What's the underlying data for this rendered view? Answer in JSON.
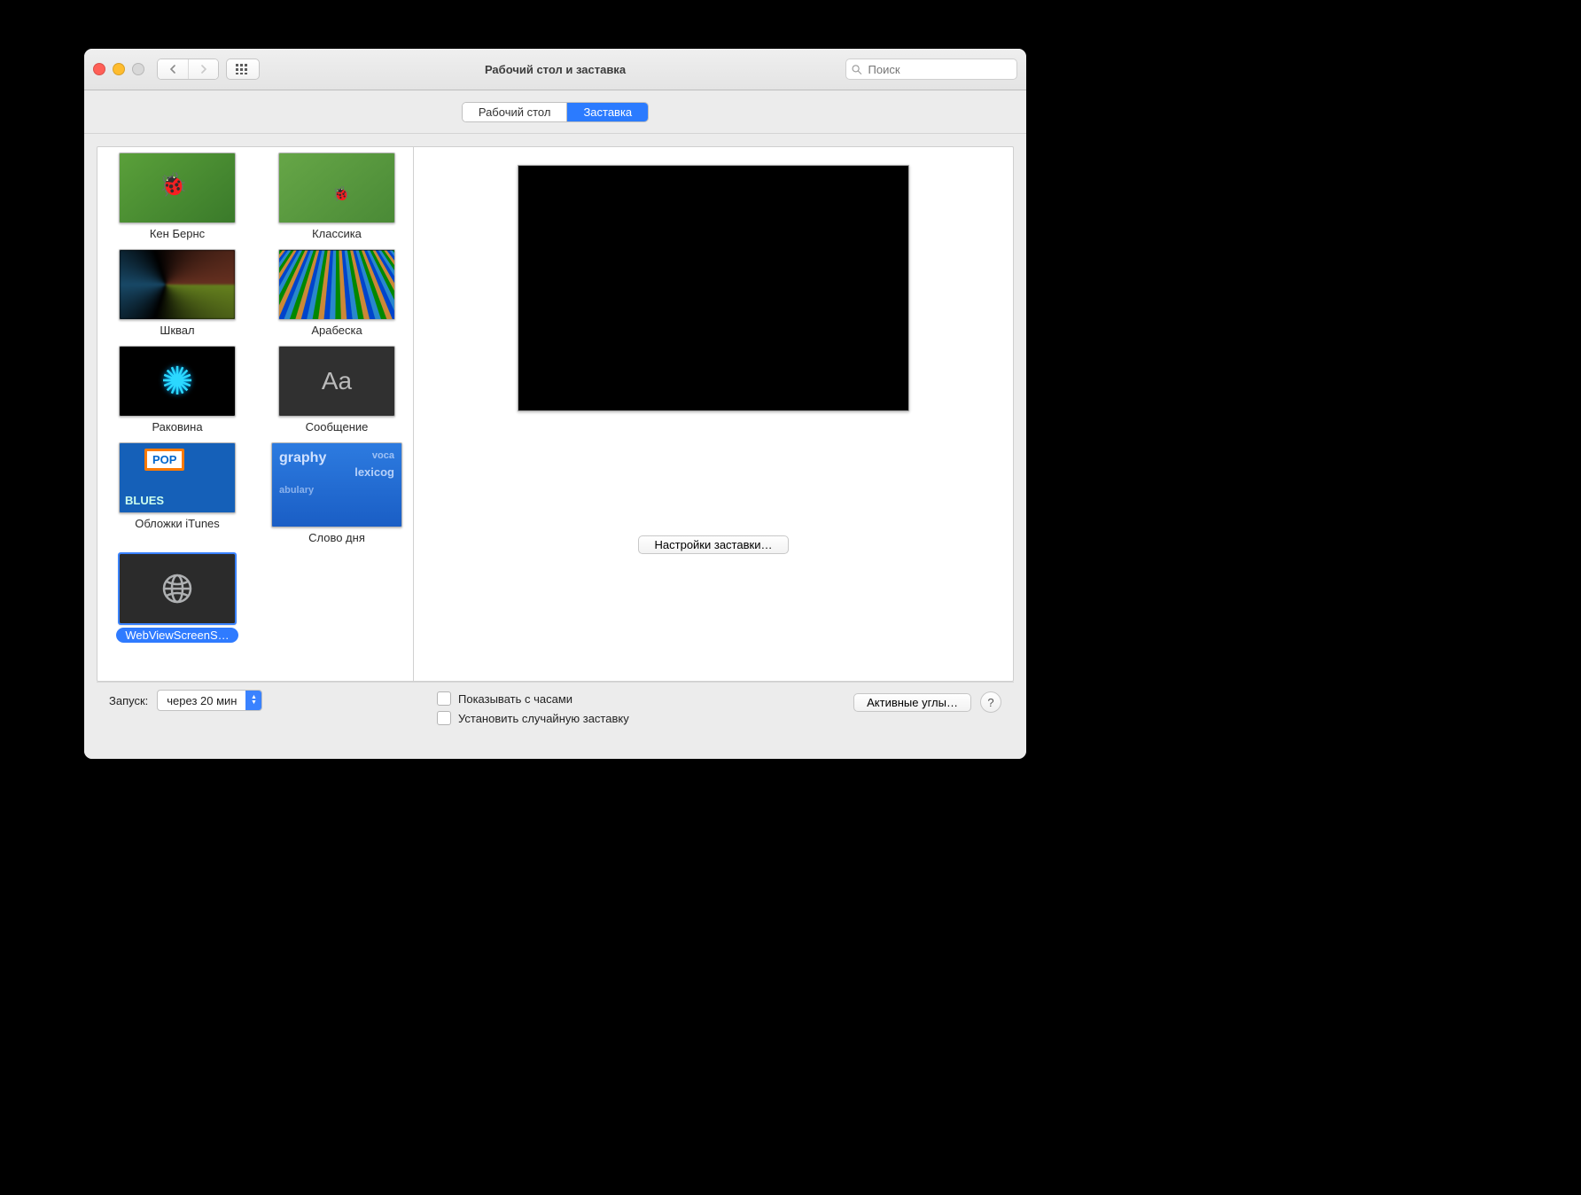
{
  "window": {
    "title": "Рабочий стол и заставка"
  },
  "search": {
    "placeholder": "Поиск"
  },
  "tabs": {
    "desktop": "Рабочий стол",
    "screensaver": "Заставка"
  },
  "savers": [
    {
      "label": "Кен Бернс"
    },
    {
      "label": "Классика"
    },
    {
      "label": "Шквал"
    },
    {
      "label": "Арабеска"
    },
    {
      "label": "Раковина"
    },
    {
      "label": "Сообщение"
    },
    {
      "label": "Обложки iTunes"
    },
    {
      "label": "Слово дня"
    },
    {
      "label": "WebViewScreenS…",
      "selected": true
    }
  ],
  "word_thumb": {
    "l1": "graphy",
    "l2": "voca",
    "l3": "lexicog",
    "l4": "abulary"
  },
  "msg_thumb": "Aa",
  "screensaver_options_button": "Настройки заставки…",
  "bottom": {
    "start_label": "Запуск:",
    "start_value": "через 20 мин",
    "show_clock": "Показывать с часами",
    "random": "Установить случайную заставку",
    "hot_corners": "Активные углы…",
    "help": "?"
  }
}
